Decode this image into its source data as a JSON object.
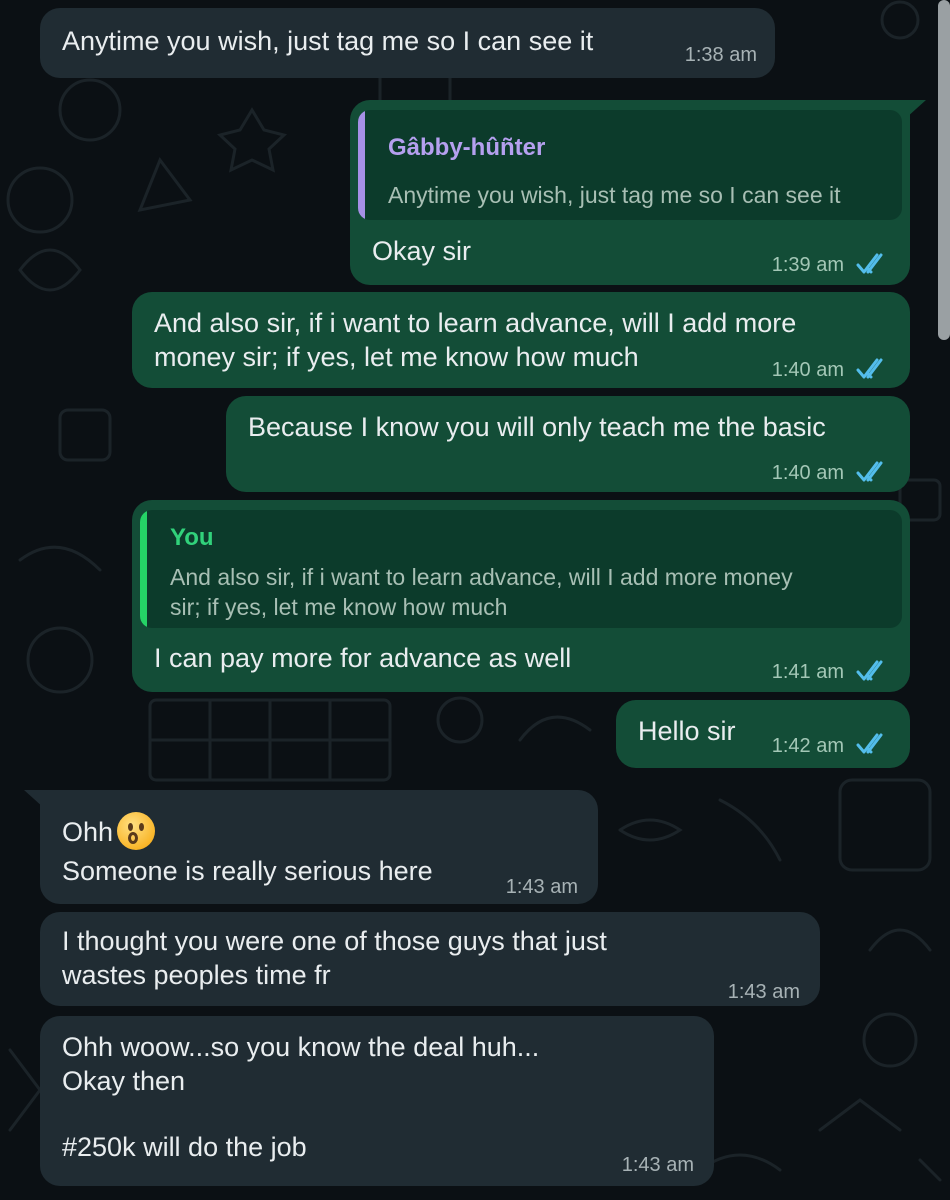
{
  "messages": [
    {
      "text": "Anytime you wish, just tag me so I can see it",
      "time": "1:38 am"
    },
    {
      "quote_name": "Gâbby-hûñter",
      "quote_text": "Anytime you wish, just tag me so I can see it",
      "text": "Okay sir",
      "time": "1:39 am"
    },
    {
      "lines": [
        "And also sir, if i want to learn advance, will I add more",
        "money sir; if yes, let me know how much"
      ],
      "time": "1:40 am"
    },
    {
      "text": "Because I know you will only teach me the basic",
      "time": "1:40 am"
    },
    {
      "quote_name": "You",
      "quote_lines": [
        "And also sir, if i want to learn advance, will I add more money",
        "sir; if yes, let me know how much"
      ],
      "text": "I can pay more for advance as well",
      "time": "1:41 am"
    },
    {
      "text": "Hello sir",
      "time": "1:42 am"
    },
    {
      "lines": [
        "Ohh",
        "Someone is really serious here"
      ],
      "emoji": "hushed-face",
      "time": "1:43 am"
    },
    {
      "lines": [
        "I thought you were one of those guys that just",
        "wastes peoples time fr"
      ],
      "time": "1:43 am"
    },
    {
      "lines": [
        "Ohh woow...so you know the deal huh...",
        "Okay then",
        "",
        "#250k will do the job"
      ],
      "time": "1:43 am"
    }
  ],
  "colors": {
    "background": "#0b1014",
    "incoming_bubble": "#202c33",
    "outgoing_bubble": "#134d37",
    "quote_bg": "#0c3b2b",
    "quote_purple": "#a690e6",
    "quote_green": "#25d366",
    "read_ticks": "#53bdeb"
  },
  "icons": {
    "read_receipt": "double-check-icon"
  }
}
